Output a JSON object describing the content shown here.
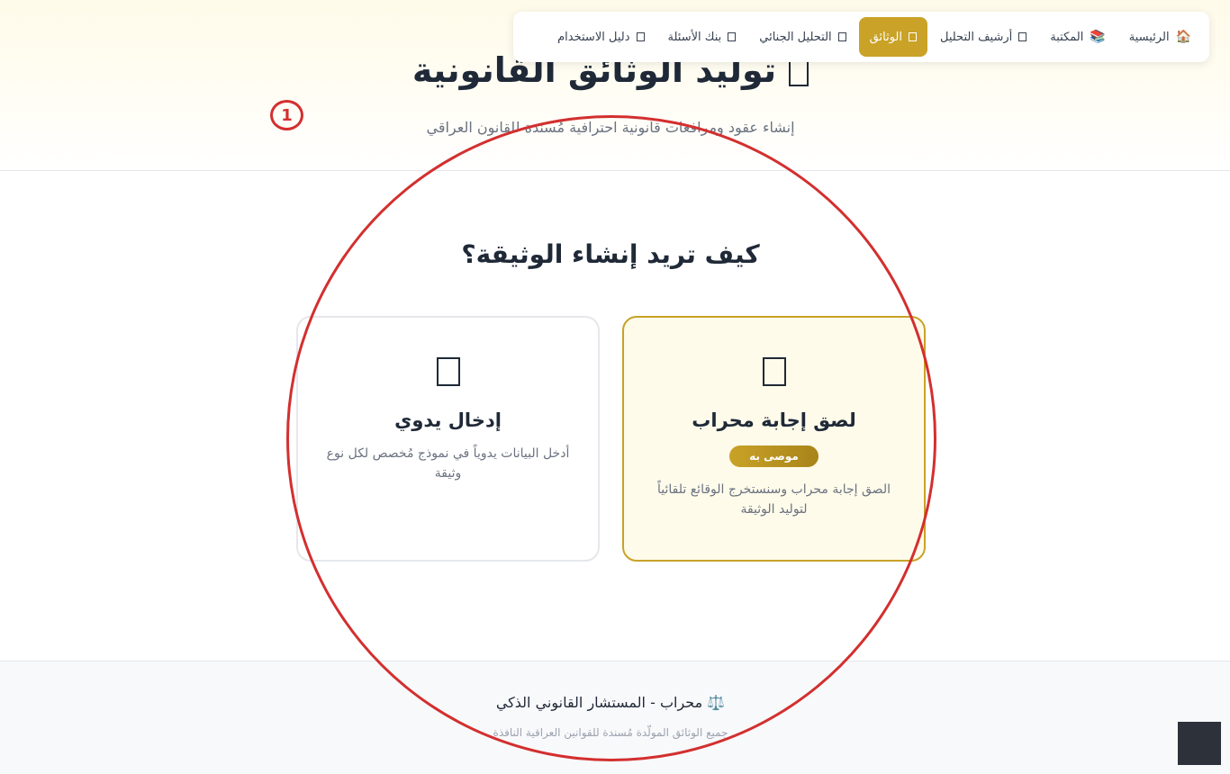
{
  "nav": {
    "items": [
      {
        "label": "الرئيسية",
        "icon": "home-icon"
      },
      {
        "label": "المكتبة",
        "icon": "books-icon"
      },
      {
        "label": "أرشيف التحليل",
        "icon": "box-icon"
      },
      {
        "label": "الوثائق",
        "icon": "box-icon",
        "active": true
      },
      {
        "label": "التحليل الجنائي",
        "icon": "box-icon"
      },
      {
        "label": "بنك الأسئلة",
        "icon": "box-icon"
      },
      {
        "label": "دليل الاستخدام",
        "icon": "box-icon"
      }
    ]
  },
  "hero": {
    "title": "توليد الوثائق القانونية",
    "subtitle": "إنشاء عقود ومرافعات قانونية احترافية مُسندة للقانون العراقي"
  },
  "annotation": {
    "marker_label": "1",
    "color": "#d32f2f"
  },
  "main": {
    "question": "كيف تريد إنشاء الوثيقة؟",
    "cards": [
      {
        "title": "لصق إجابة محراب",
        "badge": "موصى به",
        "description": "الصق إجابة محراب وسنستخرج الوقائع تلقائياً لتوليد الوثيقة"
      },
      {
        "title": "إدخال يدوي",
        "description": "أدخل البيانات يدوياً في نموذج مُخصص لكل نوع وثيقة"
      }
    ]
  },
  "footer": {
    "brand": "⚖️ محراب - المستشار القانوني الذكي",
    "note": "جميع الوثائق المولّدة مُسندة للقوانين العراقية النافذة"
  },
  "colors": {
    "accent": "#c9a227",
    "text": "#1f2937",
    "muted": "#6b7280"
  }
}
